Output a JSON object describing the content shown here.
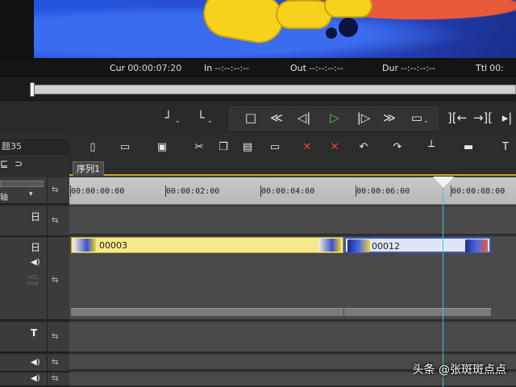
{
  "timecodes": {
    "cur_label": "Cur",
    "cur_value": "00:00:07:20",
    "in_label": "In",
    "in_value": "--:--:--:--",
    "out_label": "Out",
    "out_value": "--:--:--:--",
    "dur_label": "Dur",
    "dur_value": "--:--:--:--",
    "ttl_label": "Ttl",
    "ttl_value": "00:"
  },
  "transport": {
    "buttons": [
      "mark-in-icon",
      "mark-out-icon",
      "stop-icon",
      "rewind-icon",
      "step-back-icon",
      "play-icon",
      "step-forward-icon",
      "fast-forward-icon",
      "loop-icon",
      "go-in-icon",
      "go-out-icon",
      "trim-icon"
    ]
  },
  "left_panel": {
    "project_title": "题35",
    "track_label_partial": "轴"
  },
  "sequence": {
    "tab_label": "序列1"
  },
  "ruler": {
    "labels": [
      "00:00:00:00",
      "00:00:02:00",
      "00:00:04:00",
      "00:00:06:00",
      "00:00:08:00"
    ]
  },
  "clips": [
    {
      "name": "00003",
      "track": "video"
    },
    {
      "name": "00012",
      "track": "video"
    }
  ],
  "tracks": {
    "v_icon": "日",
    "a_icon": "🔊",
    "t_icon": "T",
    "vol_text": "VOL PAN"
  },
  "watermark": "头条 @张斑斑点点",
  "colors": {
    "playhead": "#3fc7c7",
    "clip_yellow": "#f6e98a",
    "clip_blue_border": "#3a5bbf",
    "play_green": "#4cc94c",
    "tool_red": "#e34a2a",
    "tab_underline": "#c9a227"
  }
}
